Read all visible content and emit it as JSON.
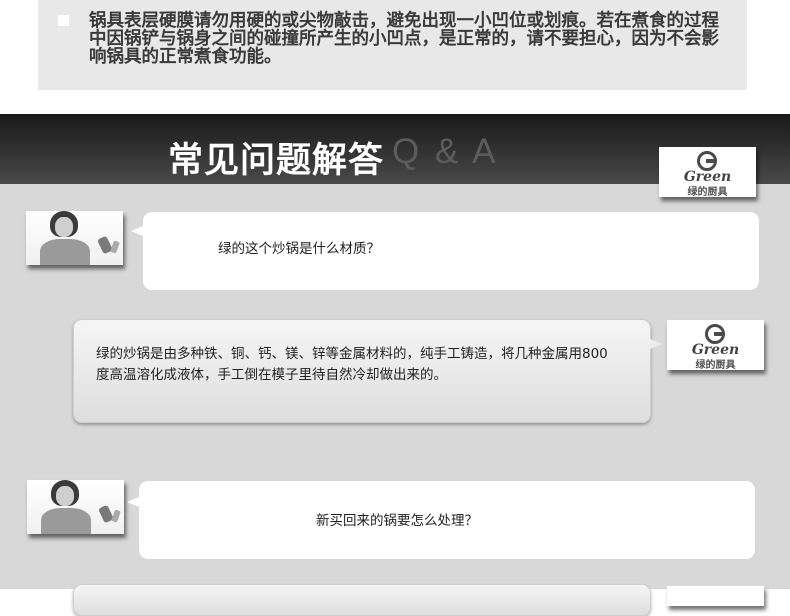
{
  "notice": {
    "text": "锅具表层硬膜请勿用硬的或尖物敲击，避免出现一小凹位或划痕。若在煮食的过程中因锅铲与锅身之间的碰撞所产生的小凹点，是正常的，请不要担心，因为不会影响锅具的正常煮食功能。"
  },
  "qa_header": {
    "title": "常见问题解答",
    "subtitle": "Q & A"
  },
  "logo": {
    "word": "Green",
    "cn": "绿的厨具"
  },
  "qa": [
    {
      "question": "绿的这个炒锅是什么材质？",
      "answer": "绿的炒锅是由多种铁、铜、钙、镁、锌等金属材料的，纯手工铸造，将几种金属用800度高温溶化成液体，手工倒在模子里待自然冷却做出来的。"
    },
    {
      "question": "新买回来的锅要怎么处理？"
    }
  ]
}
